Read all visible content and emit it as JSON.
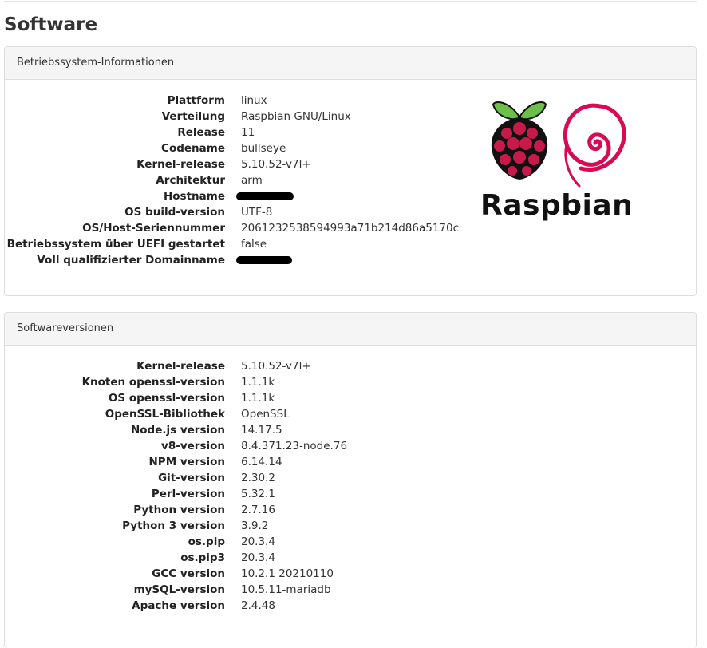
{
  "page": {
    "title": "Software"
  },
  "os_panel": {
    "heading": "Betriebssystem-Informationen",
    "rows": [
      {
        "label": "Plattform",
        "value": "linux"
      },
      {
        "label": "Verteilung",
        "value": "Raspbian GNU/Linux"
      },
      {
        "label": "Release",
        "value": "11"
      },
      {
        "label": "Codename",
        "value": "bullseye"
      },
      {
        "label": "Kernel-release",
        "value": "5.10.52-v7l+"
      },
      {
        "label": "Architektur",
        "value": "arm"
      },
      {
        "label": "Hostname",
        "value": ""
      },
      {
        "label": "OS build-version",
        "value": "UTF-8"
      },
      {
        "label": "OS/Host-Seriennummer",
        "value": "2061232538594993a71b214d86a5170c"
      },
      {
        "label": "Betriebssystem über UEFI gestartet",
        "value": "false"
      },
      {
        "label": "Voll qualifizierter Domainname",
        "value": ""
      }
    ],
    "logo": {
      "text": "Raspbian",
      "raspberry_color": "#c51a4a",
      "leaf_color": "#6cc04a",
      "swirl_color": "#d70a53"
    }
  },
  "sw_panel": {
    "heading": "Softwareversionen",
    "rows": [
      {
        "label": "Kernel-release",
        "value": "5.10.52-v7l+"
      },
      {
        "label": "Knoten openssl-version",
        "value": "1.1.1k"
      },
      {
        "label": "OS openssl-version",
        "value": "1.1.1k"
      },
      {
        "label": "OpenSSL-Bibliothek",
        "value": "OpenSSL"
      },
      {
        "label": "Node.js version",
        "value": "14.17.5"
      },
      {
        "label": "v8-version",
        "value": "8.4.371.23-node.76"
      },
      {
        "label": "NPM version",
        "value": "6.14.14"
      },
      {
        "label": "Git-version",
        "value": "2.30.2"
      },
      {
        "label": "Perl-version",
        "value": "5.32.1"
      },
      {
        "label": "Python version",
        "value": "2.7.16"
      },
      {
        "label": "Python 3 version",
        "value": "3.9.2"
      },
      {
        "label": "os.pip",
        "value": "20.3.4"
      },
      {
        "label": "os.pip3",
        "value": "20.3.4"
      },
      {
        "label": "GCC version",
        "value": "10.2.1 20210110"
      },
      {
        "label": "mySQL-version",
        "value": "10.5.11-mariadb"
      },
      {
        "label": "Apache version",
        "value": "2.4.48"
      }
    ]
  }
}
